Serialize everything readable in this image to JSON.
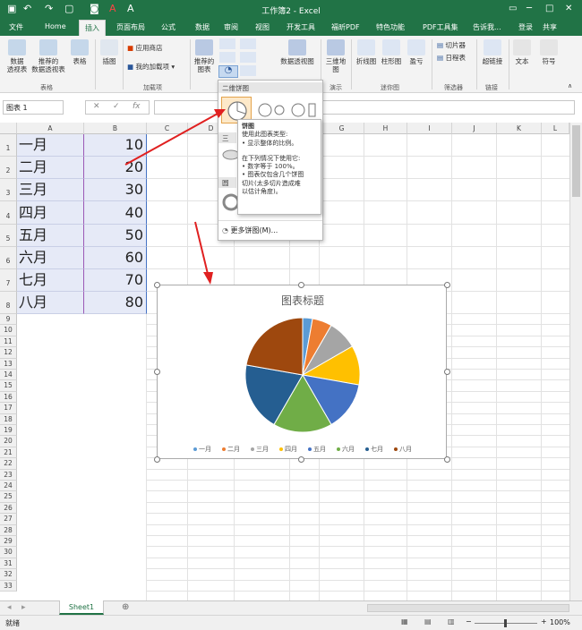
{
  "titlebar": {
    "title": "工作簿2 - Excel"
  },
  "tabs": [
    "文件",
    "Home",
    "插入",
    "页面布局",
    "公式",
    "数据",
    "审阅",
    "视图",
    "开发工具",
    "福昕PDF",
    "特色功能",
    "PDF工具集",
    "告诉我...",
    "登录",
    "共享"
  ],
  "ribbon": {
    "pivot": "数据\n透视表",
    "rec_pivot": "推荐的\n数据透视表",
    "table": "表格",
    "illus": "插图",
    "store": "应用商店",
    "myaddins": "我的加载项",
    "rec_charts": "推荐的\n图表",
    "pivot_chart": "数据透视图",
    "map3d": "三维地\n图",
    "line": "折线图",
    "column": "柱形图",
    "winloss": "盈亏",
    "slicer": "切片器",
    "timeline": "日程表",
    "hyperlink": "超链接",
    "text": "文本",
    "symbol": "符号",
    "grp_tables": "表格",
    "grp_addins": "加载项",
    "grp_tours": "演示",
    "grp_spark": "迷你图",
    "grp_filter": "筛选器",
    "grp_links": "链接"
  },
  "formula_bar": {
    "name_box": "图表 1",
    "fx": "fx"
  },
  "columns": [
    "A",
    "B",
    "C",
    "D",
    "E",
    "F",
    "G",
    "H",
    "I",
    "J",
    "K",
    "L"
  ],
  "cells": [
    [
      "一月",
      "10"
    ],
    [
      "二月",
      "20"
    ],
    [
      "三月",
      "30"
    ],
    [
      "四月",
      "40"
    ],
    [
      "五月",
      "50"
    ],
    [
      "六月",
      "60"
    ],
    [
      "七月",
      "70"
    ],
    [
      "八月",
      "80"
    ]
  ],
  "chart_data": {
    "type": "pie",
    "title": "图表标题",
    "categories": [
      "一月",
      "二月",
      "三月",
      "四月",
      "五月",
      "六月",
      "七月",
      "八月"
    ],
    "values": [
      10,
      20,
      30,
      40,
      50,
      60,
      70,
      80
    ],
    "colors": [
      "#5b9bd5",
      "#ed7d31",
      "#a5a5a5",
      "#ffc000",
      "#4472c4",
      "#70ad47",
      "#255e91",
      "#9e480e"
    ]
  },
  "dropdown": {
    "sec1": "二维饼图",
    "sec2": "三",
    "sec3": "圆",
    "more": "更多饼图(M)..."
  },
  "tooltip": {
    "title": "饼图",
    "l1": "使用此图表类型:",
    "l2": "• 显示整体的比例。",
    "l3": "在下列情况下使用它:",
    "l4": "• 数字等于 100%。",
    "l5": "• 图表仅包含几个饼图",
    "l6": "切片(太多切片造成难",
    "l7": "以估计角度)。"
  },
  "sheet": {
    "tab": "Sheet1"
  },
  "status": {
    "ready": "就绪",
    "zoom": "100%"
  }
}
